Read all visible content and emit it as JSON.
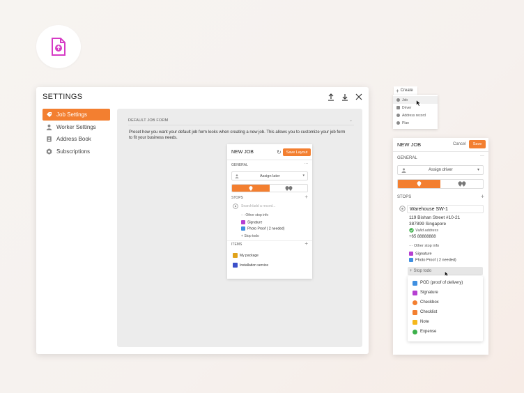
{
  "colors": {
    "accent": "#f37f30",
    "brand_icon": "#d63bc5"
  },
  "settings": {
    "title": "SETTINGS",
    "sidebar": [
      {
        "label": "Job Settings",
        "icon": "gear-tag-icon"
      },
      {
        "label": "Worker Settings",
        "icon": "person-icon"
      },
      {
        "label": "Address Book",
        "icon": "address-book-icon"
      },
      {
        "label": "Subscriptions",
        "icon": "badge-icon"
      }
    ],
    "section_title": "DEFAULT JOB FORM",
    "description": "Preset how you want your default job form looks when creating a new job. This allows you to customize your job form to fit your business needs.",
    "preview": {
      "title": "NEW JOB",
      "save_layout": "Save Layout",
      "general": "GENERAL",
      "assign_later": "Assign later",
      "stops": "STOPS",
      "search_placeholder": "Search/add a record...",
      "other_stop_info": "Other stop info",
      "signature": "Signature",
      "photo_proof": "Photo Proof ( 2 needed)",
      "stop_todo": "Stop todo",
      "items": "ITEMS",
      "my_package": "My package",
      "installation_service": "Installation service"
    }
  },
  "create": {
    "button": "Create",
    "menu": [
      "Job",
      "Driver",
      "Address record",
      "Plan"
    ]
  },
  "newjob": {
    "title": "NEW JOB",
    "cancel": "Cancel",
    "save": "Save",
    "general": "GENERAL",
    "assign_driver": "Assign driver",
    "stops": "STOPS",
    "warehouse": "Warehouse SW-1",
    "address_line1": "119 Bishan Street #10-21",
    "address_line2": "387899 Singapore",
    "valid_address": "Valid address",
    "phone": "+65 88888888",
    "other_stop_info": "Other stop info",
    "signature": "Signature",
    "photo_proof": "Photo Proof ( 2 needed)",
    "stop_todo": "Stop todo",
    "todo_menu": [
      {
        "label": "POD (proof of delivery)",
        "color": "#3f8fe0"
      },
      {
        "label": "Signature",
        "color": "#b53fd1"
      },
      {
        "label": "Checkbox",
        "color": "#f37f30"
      },
      {
        "label": "Checklist",
        "color": "#f37f30"
      },
      {
        "label": "Note",
        "color": "#f5b81c"
      },
      {
        "label": "Expense",
        "color": "#3cb04a"
      }
    ]
  }
}
